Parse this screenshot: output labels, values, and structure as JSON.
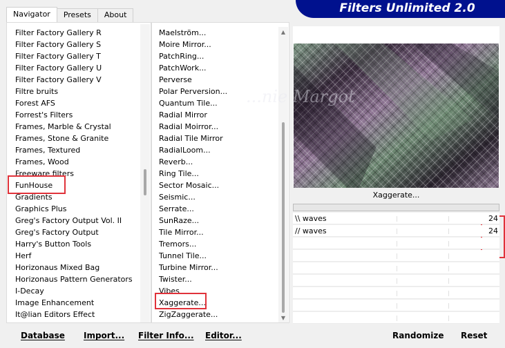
{
  "banner": {
    "title": "Filters Unlimited 2.0"
  },
  "tabs": [
    "Navigator",
    "Presets",
    "About"
  ],
  "categories": [
    "Filter Factory Gallery R",
    "Filter Factory Gallery S",
    "Filter Factory Gallery T",
    "Filter Factory Gallery U",
    "Filter Factory Gallery V",
    "Filtre bruits",
    "Forest AFS",
    "Forrest's Filters",
    "Frames, Marble & Crystal",
    "Frames, Stone & Granite",
    "Frames, Textured",
    "Frames, Wood",
    "Freeware filters",
    "FunHouse",
    "Gradients",
    "Graphics Plus",
    "Greg's Factory Output Vol. II",
    "Greg's Factory Output",
    "Harry's Button Tools",
    "Herf",
    "Horizonaus Mixed Bag",
    "Horizonaus Pattern Generators",
    "I-Decay",
    "Image Enhancement",
    "It@lian Editors Effect"
  ],
  "filters": [
    "Maelström...",
    "Moire Mirror...",
    "PatchRing...",
    "PatchWork...",
    "Perverse",
    "Polar Perversion...",
    "Quantum Tile...",
    "Radial Mirror",
    "Radial Moirror...",
    "Radial Tile Mirror",
    "RadialLoom...",
    "Reverb...",
    "Ring Tile...",
    "Sector Mosaic...",
    "Seismic...",
    "Serrate...",
    "SunRaze...",
    "Tile Mirror...",
    "Tremors...",
    "Tunnel Tile...",
    "Turbine Mirror...",
    "Twister...",
    "Vibes",
    "Xaggerate...",
    "ZigZaggerate..."
  ],
  "preview": {
    "watermark": "...nie Margot"
  },
  "selected_filter": "Xaggerate...",
  "params": [
    {
      "name": "\\\\ waves",
      "value": "24"
    },
    {
      "name": "// waves",
      "value": "24"
    }
  ],
  "buttons": {
    "database": "Database",
    "import": "Import...",
    "filter_info": "Filter Info...",
    "editor": "Editor...",
    "randomize": "Randomize",
    "reset": "Reset"
  },
  "colors": {
    "banner": "#00118e",
    "highlight": "#e0323a"
  }
}
